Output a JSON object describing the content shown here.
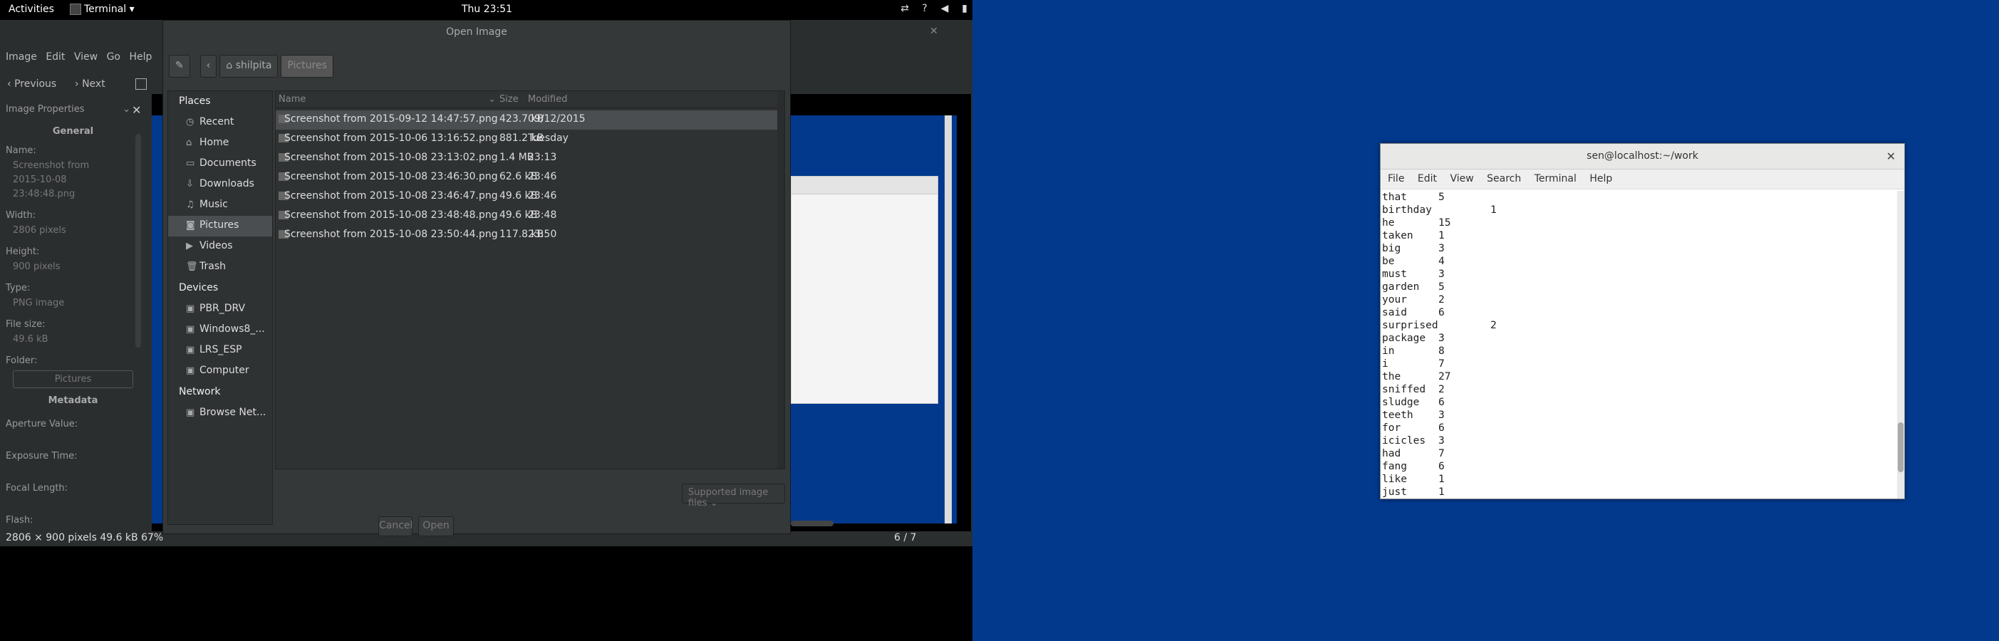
{
  "topbar": {
    "activities": "Activities",
    "app_menu": "Terminal ▾",
    "clock": "Thu 23:51"
  },
  "image_viewer": {
    "menu": [
      "Image",
      "Edit",
      "View",
      "Go",
      "Help"
    ],
    "toolbar": {
      "previous": "Previous",
      "next": "Next"
    },
    "sidebar": {
      "header": "Image Properties",
      "general": "General",
      "name_label": "Name:",
      "name_value": "Screenshot from 2015-10-08 23:48:48.png",
      "width_label": "Width:",
      "width_value": "2806 pixels",
      "height_label": "Height:",
      "height_value": "900 pixels",
      "type_label": "Type:",
      "type_value": "PNG image",
      "filesize_label": "File size:",
      "filesize_value": "49.6 kB",
      "folder_label": "Folder:",
      "folder_button": "Pictures",
      "metadata": "Metadata",
      "aperture": "Aperture Value:",
      "exposure": "Exposure Time:",
      "focal": "Focal Length:",
      "flash": "Flash:"
    },
    "status": {
      "left": "2806 × 900 pixels  49.6 kB   67%",
      "right": "6 / 7"
    }
  },
  "dialog": {
    "title": "Open Image",
    "path": [
      "shilpita",
      "Pictures"
    ],
    "places_header": "Places",
    "places": [
      {
        "label": "Recent",
        "icon": "clock-icon"
      },
      {
        "label": "Home",
        "icon": "home-icon"
      },
      {
        "label": "Documents",
        "icon": "folder-icon"
      },
      {
        "label": "Downloads",
        "icon": "download-icon"
      },
      {
        "label": "Music",
        "icon": "music-icon"
      },
      {
        "label": "Pictures",
        "icon": "camera-icon"
      },
      {
        "label": "Videos",
        "icon": "video-icon"
      },
      {
        "label": "Trash",
        "icon": "trash-icon"
      }
    ],
    "devices_header": "Devices",
    "devices": [
      "PBR_DRV",
      "Windows8_...",
      "LRS_ESP",
      "Computer"
    ],
    "network_header": "Network",
    "network": [
      "Browse Net..."
    ],
    "columns": {
      "name": "Name",
      "size": "Size",
      "modified": "Modified"
    },
    "files": [
      {
        "name": "Screenshot from 2015-09-12 14:47:57.png",
        "size": "423.7 kB",
        "modified": "09/12/2015"
      },
      {
        "name": "Screenshot from 2015-10-06 13:16:52.png",
        "size": "881.2 kB",
        "modified": "Tuesday"
      },
      {
        "name": "Screenshot from 2015-10-08 23:13:02.png",
        "size": "1.4 MB",
        "modified": "23:13"
      },
      {
        "name": "Screenshot from 2015-10-08 23:46:30.png",
        "size": "62.6 kB",
        "modified": "23:46"
      },
      {
        "name": "Screenshot from 2015-10-08 23:46:47.png",
        "size": "49.6 kB",
        "modified": "23:46"
      },
      {
        "name": "Screenshot from 2015-10-08 23:48:48.png",
        "size": "49.6 kB",
        "modified": "23:48"
      },
      {
        "name": "Screenshot from 2015-10-08 23:50:44.png",
        "size": "117.8 kB",
        "modified": "23:50"
      }
    ],
    "filter": "Supported image files",
    "cancel": "Cancel",
    "open": "Open"
  },
  "terminal": {
    "title": "sen@localhost:~/work",
    "menu": [
      "File",
      "Edit",
      "View",
      "Search",
      "Terminal",
      "Help"
    ],
    "lines": [
      {
        "word": "that",
        "count": "5"
      },
      {
        "word": "birthday",
        "count": "1"
      },
      {
        "word": "he",
        "count": "15"
      },
      {
        "word": "taken",
        "count": "1"
      },
      {
        "word": "big",
        "count": "3"
      },
      {
        "word": "be",
        "count": "4"
      },
      {
        "word": "must",
        "count": "3"
      },
      {
        "word": "garden",
        "count": "5"
      },
      {
        "word": "your",
        "count": "2"
      },
      {
        "word": "said",
        "count": "6"
      },
      {
        "word": "surprised",
        "count": "2"
      },
      {
        "word": "package",
        "count": "3"
      },
      {
        "word": "in",
        "count": "8"
      },
      {
        "word": "i",
        "count": "7"
      },
      {
        "word": "the",
        "count": "27"
      },
      {
        "word": "sniffed",
        "count": "2"
      },
      {
        "word": "sludge",
        "count": "6"
      },
      {
        "word": "teeth",
        "count": "3"
      },
      {
        "word": "for",
        "count": "6"
      },
      {
        "word": "icicles",
        "count": "3"
      },
      {
        "word": "had",
        "count": "7"
      },
      {
        "word": "fang",
        "count": "6"
      },
      {
        "word": "like",
        "count": "1"
      },
      {
        "word": "just",
        "count": "1"
      }
    ]
  }
}
